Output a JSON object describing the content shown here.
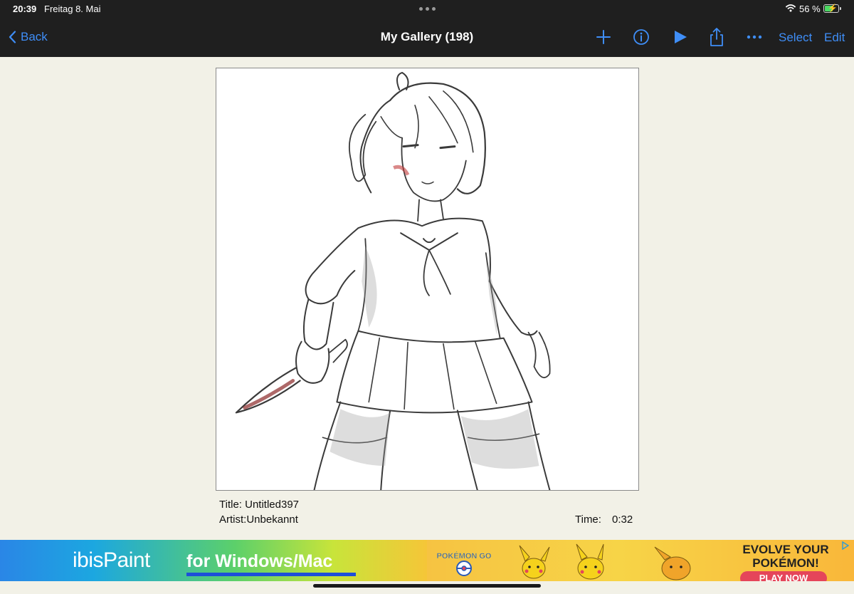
{
  "status_bar": {
    "time": "20:39",
    "date": "Freitag 8. Mai",
    "battery_text": "56 %",
    "battery_level": 0.56,
    "wifi_icon": "wifi-icon",
    "battery_icon": "battery-charging-icon"
  },
  "navbar": {
    "back_label": "Back",
    "title": "My Gallery (198)",
    "icons": [
      "plus-icon",
      "info-icon",
      "play-icon",
      "share-icon",
      "more-icon"
    ],
    "select_label": "Select",
    "edit_label": "Edit",
    "accent_color": "#3f8ef7"
  },
  "artwork": {
    "title_line": "Title: Untitled397",
    "artist_line": "Artist:Unbekannt",
    "time_label": "Time:",
    "time_value": "0:32"
  },
  "ads": {
    "left": {
      "brand": "ibisPaint",
      "tagline": "for Windows/Mac"
    },
    "right": {
      "logo": "POKÉMON GO",
      "headline": "EVOLVE YOUR POKÉMON!",
      "button": "PLAY NOW"
    }
  }
}
